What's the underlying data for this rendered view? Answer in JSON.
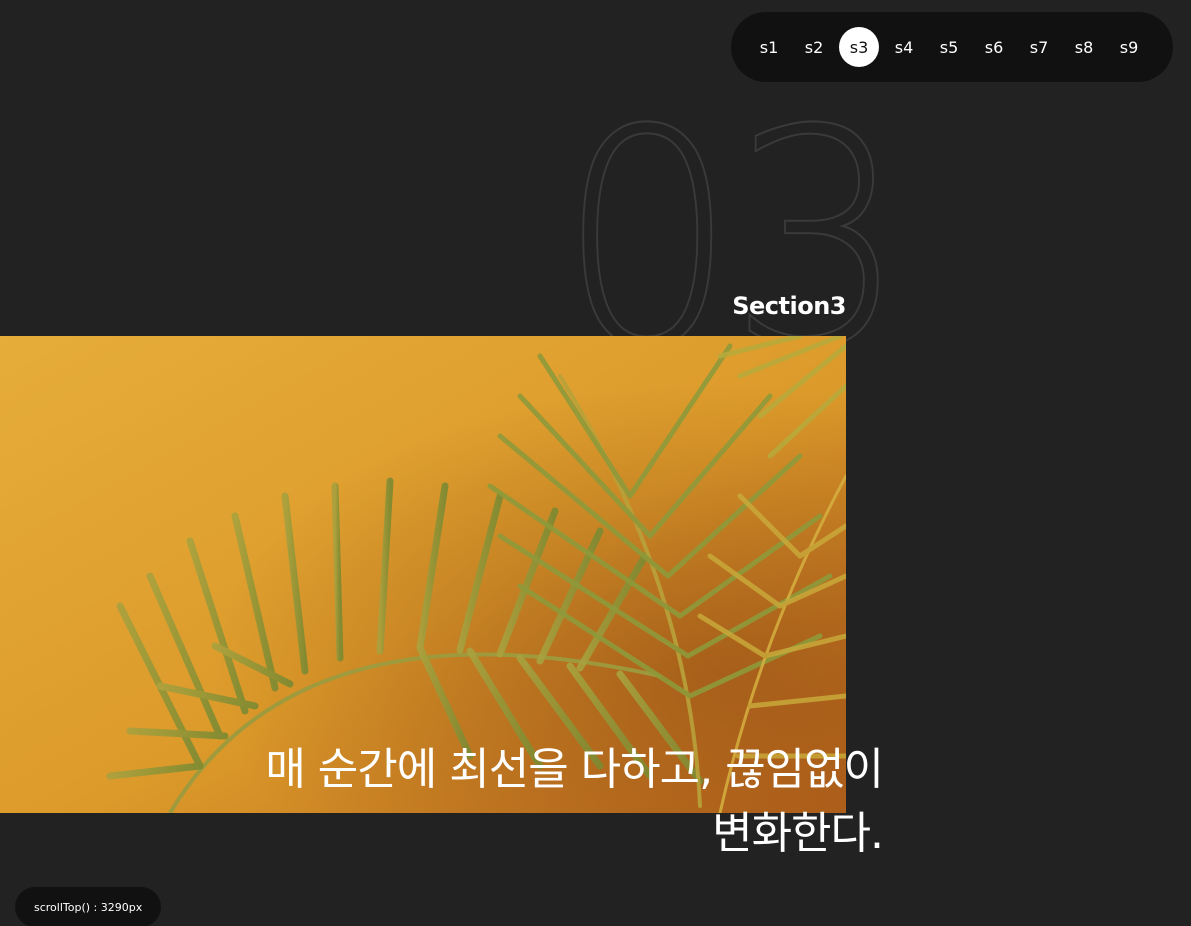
{
  "nav": {
    "items": [
      {
        "label": "s1",
        "active": false
      },
      {
        "label": "s2",
        "active": false
      },
      {
        "label": "s3",
        "active": true
      },
      {
        "label": "s4",
        "active": false
      },
      {
        "label": "s5",
        "active": false
      },
      {
        "label": "s6",
        "active": false
      },
      {
        "label": "s7",
        "active": false
      },
      {
        "label": "s8",
        "active": false
      },
      {
        "label": "s9",
        "active": false
      }
    ]
  },
  "section": {
    "number": "03",
    "label": "Section3",
    "headline_line1": "매 순간에 최선을 다하고, 끊임없이",
    "headline_line2": "변화한다.",
    "image_icon": "palm-leaves-photo"
  },
  "scroll": {
    "readout": "scrollTop() : 3290px"
  },
  "colors": {
    "background": "#222222",
    "nav_bg": "#111111",
    "active_dot": "#ffffff",
    "image_wall": "#e0a631"
  }
}
